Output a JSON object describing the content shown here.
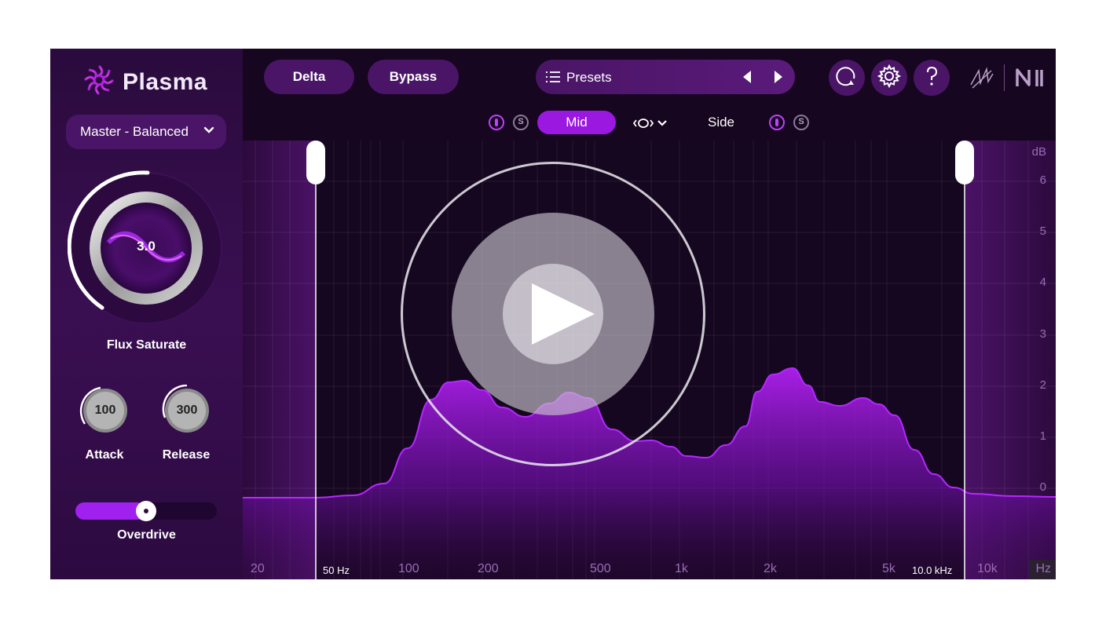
{
  "app": {
    "name": "Plasma"
  },
  "preset_select": {
    "value": "Master - Balanced"
  },
  "knobs": {
    "main": {
      "value": "3.0",
      "label": "Flux Saturate"
    },
    "attack": {
      "value": "100",
      "label": "Attack"
    },
    "release": {
      "value": "300",
      "label": "Release"
    }
  },
  "overdrive": {
    "label": "Overdrive",
    "level": 0.5
  },
  "header": {
    "delta_label": "Delta",
    "bypass_label": "Bypass",
    "presets_label": "Presets"
  },
  "mid_side": {
    "mid_label": "Mid",
    "side_label": "Side",
    "solo_label": "S"
  },
  "analyzer": {
    "db_unit": "dB",
    "db_ticks": [
      "6",
      "5",
      "4",
      "3",
      "2",
      "1",
      "0"
    ],
    "freq_unit": "Hz",
    "freq_ticks": [
      "20",
      "100",
      "200",
      "500",
      "1k",
      "2k",
      "5k",
      "10k"
    ],
    "low_cut_label": "50 Hz",
    "high_cut_label": "10.0 kHz"
  },
  "colors": {
    "accent": "#a020f0",
    "panel": "#2a0b3d",
    "button": "#4a1566",
    "tick": "#9a6db5"
  }
}
